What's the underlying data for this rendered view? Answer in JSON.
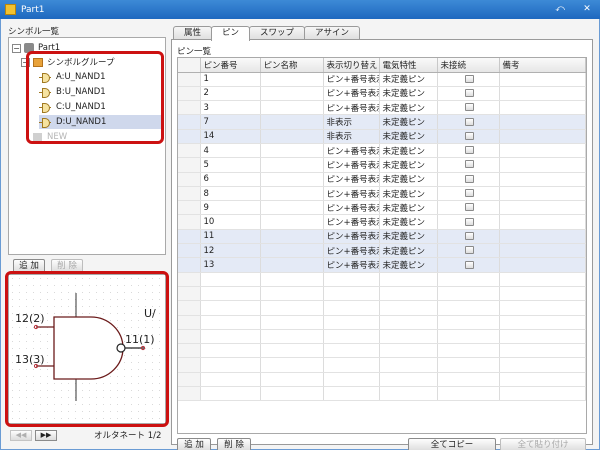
{
  "window": {
    "title": "Part1"
  },
  "left": {
    "symbol_list_title": "シンボル一覧",
    "tree": {
      "root": "Part1",
      "group": "シンボルグループ",
      "symbols": [
        "A:U_NAND1",
        "B:U_NAND1",
        "C:U_NAND1",
        "D:U_NAND1"
      ],
      "selected_index": 3,
      "new_item": "NEW"
    },
    "add_label": "追 加",
    "delete_label": "削 除",
    "preview": {
      "pin_in1": "12(2)",
      "pin_in2": "13(3)",
      "pin_out": "11(1)",
      "ref_label": "U/"
    },
    "alt_net_label": "オルタネート 1/2",
    "nav_prev": "◀◀",
    "nav_next": "▶▶"
  },
  "tabs": [
    {
      "label": "属性",
      "active": false
    },
    {
      "label": "ピン",
      "active": true
    },
    {
      "label": "スワップ",
      "active": false
    },
    {
      "label": "アサイン",
      "active": false
    }
  ],
  "pin_panel": {
    "title": "ピン一覧",
    "columns": [
      "ピン番号",
      "ピン名称",
      "表示切り替え",
      "電気特性",
      "未接続",
      "備考"
    ],
    "rows": [
      {
        "num": "1",
        "name": "",
        "disp": "ピン+番号表示",
        "elec": "未定義ピン",
        "nc": false,
        "note": "",
        "hl": false
      },
      {
        "num": "2",
        "name": "",
        "disp": "ピン+番号表示",
        "elec": "未定義ピン",
        "nc": false,
        "note": "",
        "hl": false
      },
      {
        "num": "3",
        "name": "",
        "disp": "ピン+番号表示",
        "elec": "未定義ピン",
        "nc": false,
        "note": "",
        "hl": false
      },
      {
        "num": "7",
        "name": "",
        "disp": "非表示",
        "elec": "未定義ピン",
        "nc": false,
        "note": "",
        "hl": true
      },
      {
        "num": "14",
        "name": "",
        "disp": "非表示",
        "elec": "未定義ピン",
        "nc": false,
        "note": "",
        "hl": true
      },
      {
        "num": "4",
        "name": "",
        "disp": "ピン+番号表示",
        "elec": "未定義ピン",
        "nc": false,
        "note": "",
        "hl": false
      },
      {
        "num": "5",
        "name": "",
        "disp": "ピン+番号表示",
        "elec": "未定義ピン",
        "nc": false,
        "note": "",
        "hl": false
      },
      {
        "num": "6",
        "name": "",
        "disp": "ピン+番号表示",
        "elec": "未定義ピン",
        "nc": false,
        "note": "",
        "hl": false
      },
      {
        "num": "8",
        "name": "",
        "disp": "ピン+番号表示",
        "elec": "未定義ピン",
        "nc": false,
        "note": "",
        "hl": false
      },
      {
        "num": "9",
        "name": "",
        "disp": "ピン+番号表示",
        "elec": "未定義ピン",
        "nc": false,
        "note": "",
        "hl": false
      },
      {
        "num": "10",
        "name": "",
        "disp": "ピン+番号表示",
        "elec": "未定義ピン",
        "nc": false,
        "note": "",
        "hl": false
      },
      {
        "num": "11",
        "name": "",
        "disp": "ピン+番号表示",
        "elec": "未定義ピン",
        "nc": false,
        "note": "",
        "hl": true
      },
      {
        "num": "12",
        "name": "",
        "disp": "ピン+番号表示",
        "elec": "未定義ピン",
        "nc": false,
        "note": "",
        "hl": true
      },
      {
        "num": "13",
        "name": "",
        "disp": "ピン+番号表示",
        "elec": "未定義ピン",
        "nc": false,
        "note": "",
        "hl": true
      }
    ],
    "add_label": "追 加",
    "delete_label": "削 除",
    "copy_all_label": "全てコピー",
    "paste_all_label": "全て貼り付け"
  },
  "colors": {
    "titlebar": "#1e68bf",
    "highlight": "#cc1111",
    "pin_marker": "#b8323c",
    "gate_outline": "#6b1a1a"
  }
}
